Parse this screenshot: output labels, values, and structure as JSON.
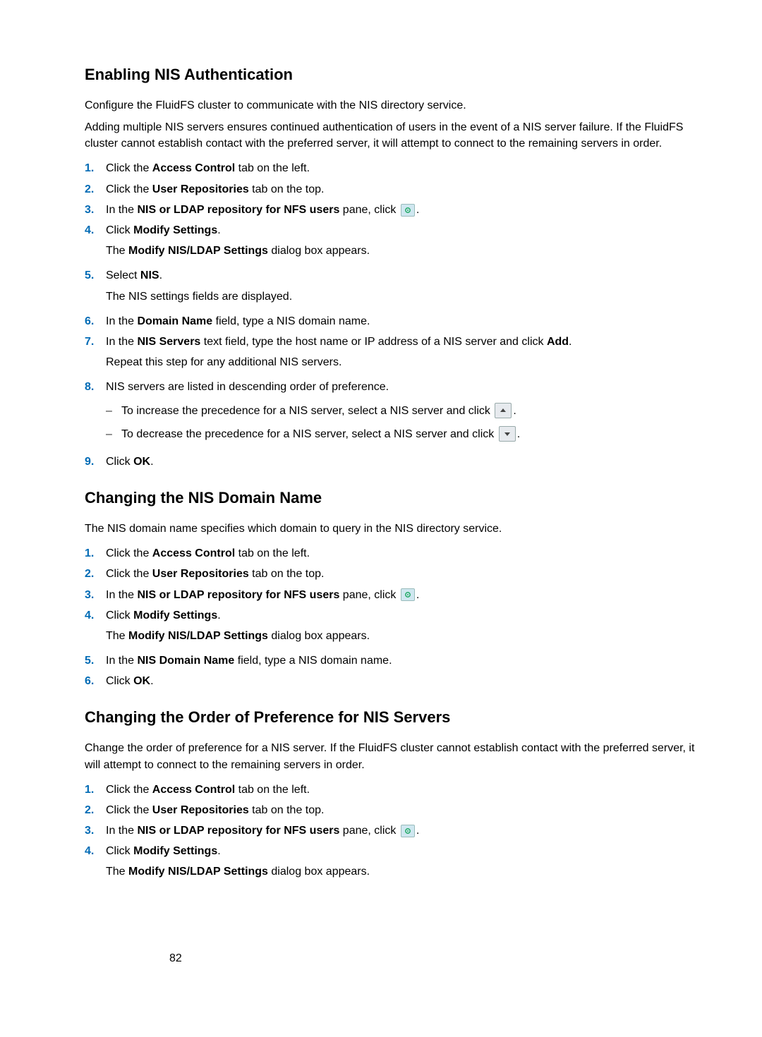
{
  "section1": {
    "heading": "Enabling NIS Authentication",
    "intro1": "Configure the FluidFS cluster to communicate with the NIS directory service.",
    "intro2": "Adding multiple NIS servers ensures continued authentication of users in the event of a NIS server failure. If the FluidFS cluster cannot establish contact with the preferred server, it will attempt to connect to the remaining servers in order.",
    "steps": {
      "s1": {
        "num": "1.",
        "pre": "Click the ",
        "b1": "Access Control",
        "post": " tab on the left."
      },
      "s2": {
        "num": "2.",
        "pre": "Click the ",
        "b1": "User Repositories",
        "post": " tab on the top."
      },
      "s3": {
        "num": "3.",
        "pre": "In the ",
        "b1": "NIS or LDAP repository for NFS users",
        "mid": " pane, click ",
        "post": "."
      },
      "s4": {
        "num": "4.",
        "l1_pre": "Click ",
        "l1_b": "Modify Settings",
        "l1_post": ".",
        "l2_pre": "The ",
        "l2_b": "Modify NIS/LDAP Settings",
        "l2_post": " dialog box appears."
      },
      "s5": {
        "num": "5.",
        "l1_pre": "Select ",
        "l1_b": "NIS",
        "l1_post": ".",
        "l2": "The NIS settings fields are displayed."
      },
      "s6": {
        "num": "6.",
        "pre": "In the ",
        "b1": "Domain Name",
        "post": " field, type a NIS domain name."
      },
      "s7": {
        "num": "7.",
        "l1_pre": "In the ",
        "l1_b1": "NIS Servers",
        "l1_mid": " text field, type the host name or IP address of a NIS server and click ",
        "l1_b2": "Add",
        "l1_post": ".",
        "l2": "Repeat this step for any additional NIS servers."
      },
      "s8": {
        "num": "8.",
        "l1": "NIS servers are listed in descending order of preference.",
        "sub1_pre": "To increase the precedence for a NIS server, select a NIS server and click ",
        "sub1_post": ".",
        "sub2_pre": "To decrease the precedence for a NIS server, select a NIS server and click ",
        "sub2_post": "."
      },
      "s9": {
        "num": "9.",
        "pre": "Click ",
        "b1": "OK",
        "post": "."
      }
    }
  },
  "section2": {
    "heading": "Changing the NIS Domain Name",
    "intro": "The NIS domain name specifies which domain to query in the NIS directory service.",
    "steps": {
      "s1": {
        "num": "1.",
        "pre": "Click the ",
        "b1": "Access Control",
        "post": " tab on the left."
      },
      "s2": {
        "num": "2.",
        "pre": "Click the ",
        "b1": "User Repositories",
        "post": " tab on the top."
      },
      "s3": {
        "num": "3.",
        "pre": "In the ",
        "b1": "NIS or LDAP repository for NFS users",
        "mid": " pane, click ",
        "post": "."
      },
      "s4": {
        "num": "4.",
        "l1_pre": "Click ",
        "l1_b": "Modify Settings",
        "l1_post": ".",
        "l2_pre": "The ",
        "l2_b": "Modify NIS/LDAP Settings",
        "l2_post": " dialog box appears."
      },
      "s5": {
        "num": "5.",
        "pre": "In the ",
        "b1": "NIS Domain Name",
        "post": " field, type a NIS domain name."
      },
      "s6": {
        "num": "6.",
        "pre": "Click ",
        "b1": "OK",
        "post": "."
      }
    }
  },
  "section3": {
    "heading": "Changing the Order of Preference for NIS Servers",
    "intro": "Change the order of preference for a NIS server. If the FluidFS cluster cannot establish contact with the preferred server, it will attempt to connect to the remaining servers in order.",
    "steps": {
      "s1": {
        "num": "1.",
        "pre": "Click the ",
        "b1": "Access Control",
        "post": " tab on the left."
      },
      "s2": {
        "num": "2.",
        "pre": "Click the ",
        "b1": "User Repositories",
        "post": " tab on the top."
      },
      "s3": {
        "num": "3.",
        "pre": "In the ",
        "b1": "NIS or LDAP repository for NFS users",
        "mid": " pane, click ",
        "post": "."
      },
      "s4": {
        "num": "4.",
        "l1_pre": "Click ",
        "l1_b": "Modify Settings",
        "l1_post": ".",
        "l2_pre": "The ",
        "l2_b": "Modify NIS/LDAP Settings",
        "l2_post": " dialog box appears."
      }
    }
  },
  "page_number": "82"
}
